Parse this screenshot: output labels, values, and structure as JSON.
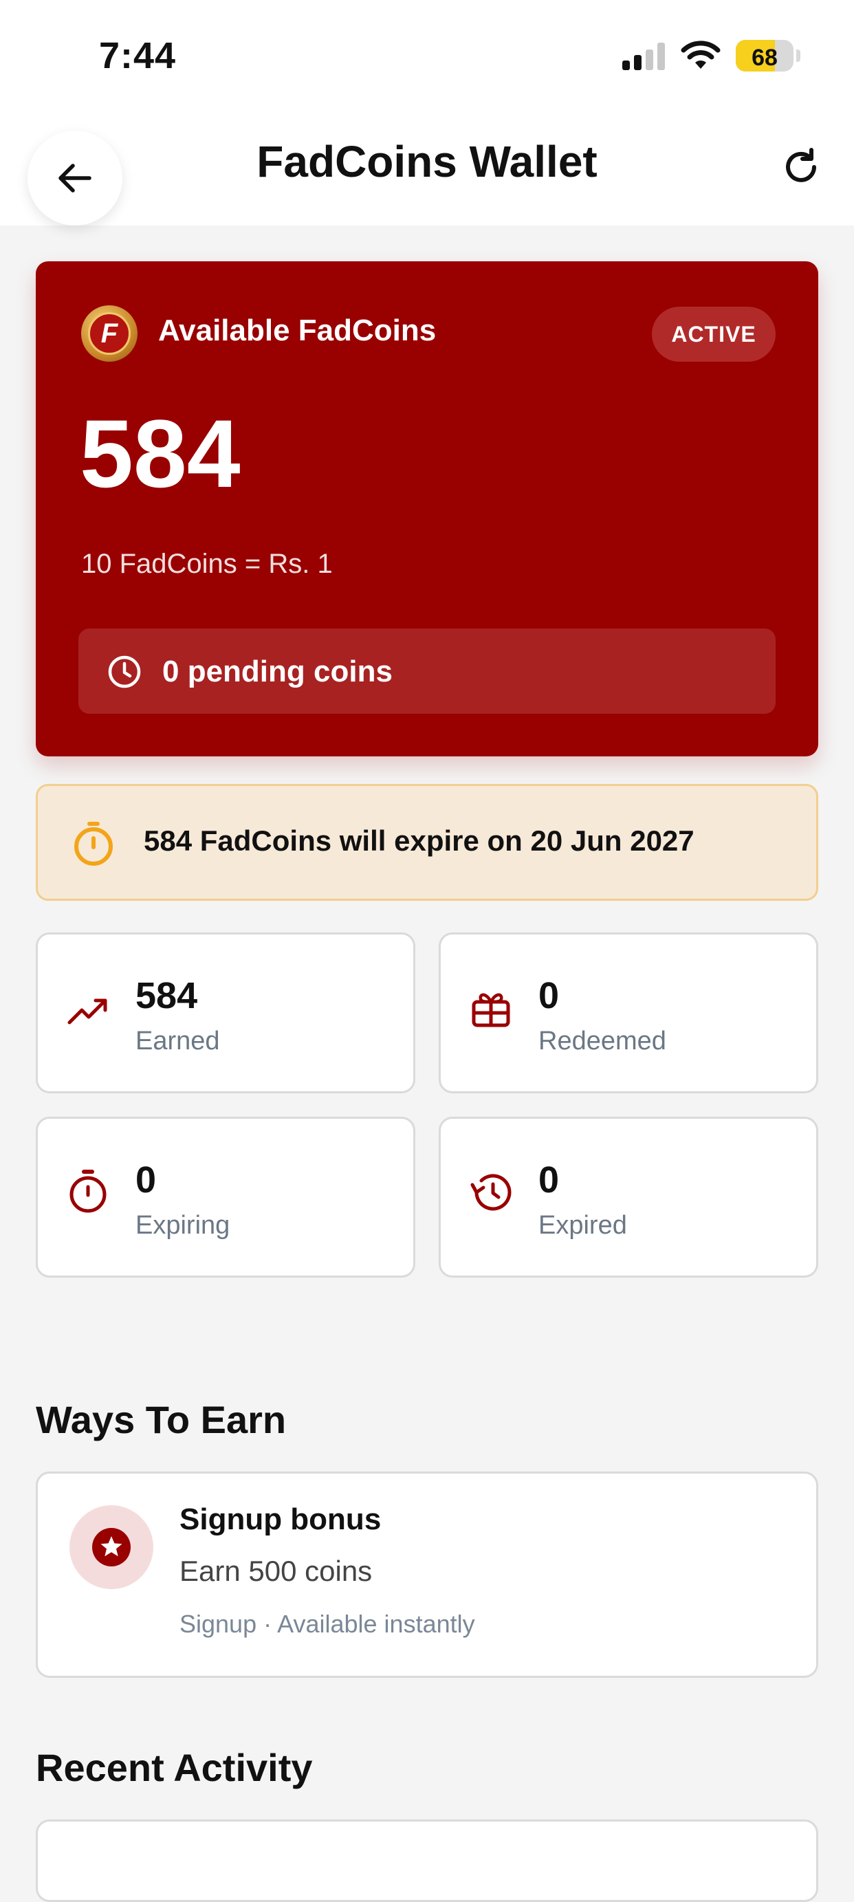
{
  "status_bar": {
    "time": "7:44",
    "battery": "68",
    "battery_level_percent": 68
  },
  "header": {
    "title": "FadCoins Wallet",
    "back_icon": "arrow-left-icon",
    "refresh_icon": "refresh-icon"
  },
  "balance_card": {
    "label": "Available FadCoins",
    "status_badge": "ACTIVE",
    "amount": "584",
    "rate": "10 FadCoins = Rs. 1",
    "pending": "0 pending coins",
    "background_color": "#990000"
  },
  "expiry_notice": {
    "text": "584 FadCoins will expire on 20 Jun 2027",
    "icon": "stopwatch-icon",
    "accent_color": "#f2a51a"
  },
  "stats": [
    {
      "value": "584",
      "label": "Earned",
      "icon": "trending-up-icon"
    },
    {
      "value": "0",
      "label": "Redeemed",
      "icon": "gift-icon"
    },
    {
      "value": "0",
      "label": "Expiring",
      "icon": "stopwatch-icon"
    },
    {
      "value": "0",
      "label": "Expired",
      "icon": "history-icon"
    }
  ],
  "ways_to_earn": {
    "title": "Ways To Earn",
    "items": [
      {
        "title": "Signup bonus",
        "subtitle": "Earn 500 coins",
        "meta": "Signup · Available instantly",
        "icon": "star-badge-icon"
      }
    ]
  },
  "recent_activity": {
    "title": "Recent Activity"
  }
}
